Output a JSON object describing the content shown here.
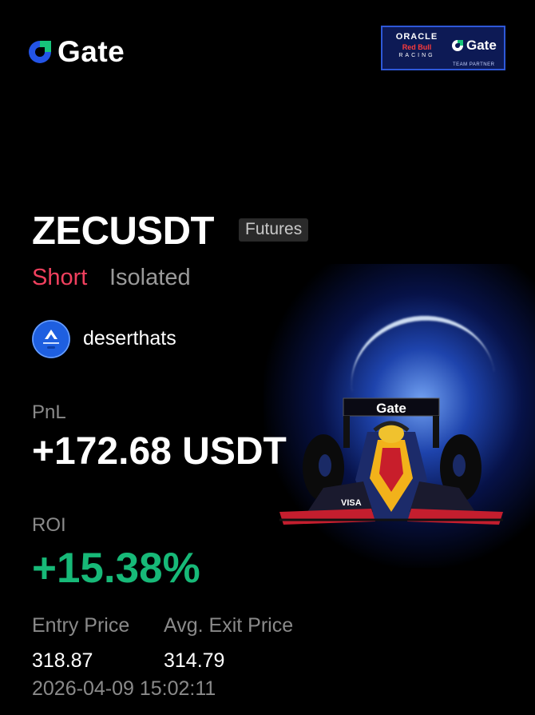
{
  "brand": {
    "name": "Gate",
    "accent": "#2354e6"
  },
  "partner_badge": {
    "oracle": "ORACLE",
    "redbull": "Red Bull",
    "racing": "RACING",
    "gate": "Gate",
    "team_partner": "TEAM PARTNER"
  },
  "position": {
    "symbol": "ZECUSDT",
    "market_type": "Futures",
    "side": "Short",
    "margin_mode": "Isolated",
    "side_color": "#f0405e"
  },
  "user": {
    "name": "deserthats",
    "avatar_icon": "alltoscan-avatar-icon"
  },
  "stats": {
    "pnl_label": "PnL",
    "pnl_value": "+172.68 USDT",
    "roi_label": "ROI",
    "roi_value": "+15.38%",
    "roi_color": "#17b978"
  },
  "prices": {
    "entry_label": "Entry Price",
    "exit_label": "Avg. Exit Price",
    "entry_value": "318.87",
    "exit_value": "314.79",
    "timestamp": "2026-04-09 15:02:11"
  },
  "car_livery": {
    "wing_text": "Gate",
    "sidepod_text": "VISA"
  }
}
